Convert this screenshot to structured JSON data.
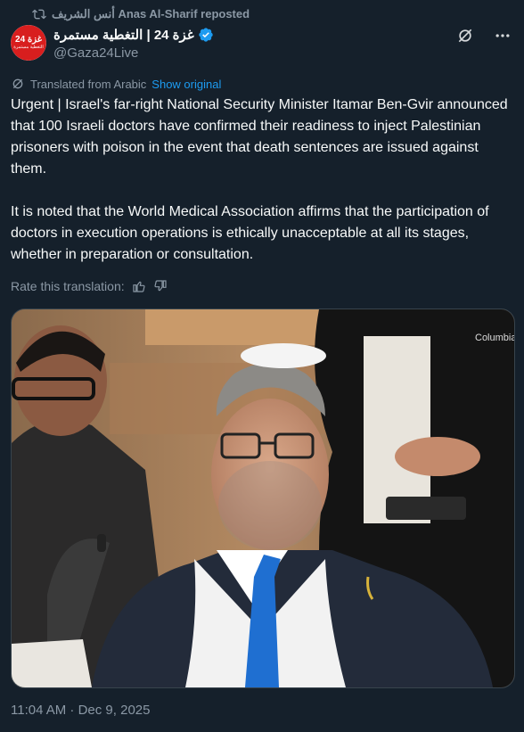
{
  "repost": {
    "label": "أنس الشريف Anas Al-Sharif reposted"
  },
  "author": {
    "name": "غزة 24 | التغطية مستمرة",
    "handle": "@Gaza24Live",
    "avatar_text": "غزة 24",
    "avatar_sub": "التغطية مستمرة"
  },
  "translation": {
    "label": "Translated from Arabic",
    "show_original": "Show original"
  },
  "tweet": {
    "text": "Urgent | Israel's far-right National Security Minister Itamar Ben-Gvir announced that 100 Israeli doctors have confirmed their readiness to inject Palestinian prisoners with poison in the event that death sentences are issued against them.\n\nIt is noted that the World Medical Association affirms that the participation of doctors in execution operations is ethically unacceptable at all its stages, whether in preparation or consultation."
  },
  "rate": {
    "label": "Rate this translation:"
  },
  "media": {
    "jacket_brand": "Columbia"
  },
  "timestamp": "11:04 AM · Dec 9, 2025",
  "colors": {
    "background": "#15202b",
    "text": "#f7f9f9",
    "muted": "#8b98a5",
    "accent": "#1d9bf0",
    "tie": "#1f6fd1"
  },
  "icons": [
    "repost-icon",
    "verified-badge-icon",
    "grok-icon",
    "more-icon",
    "translate-icon",
    "thumbs-up-icon",
    "thumbs-down-icon"
  ]
}
